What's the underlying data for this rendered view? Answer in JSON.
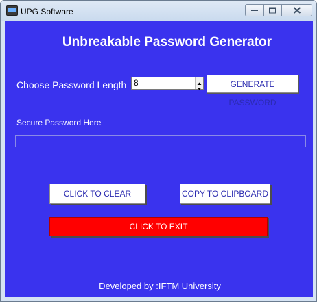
{
  "window": {
    "title": "UPG Software",
    "icon": "app-window-icon",
    "controls": {
      "minimize_icon": "minimize-icon",
      "maximize_icon": "maximize-icon",
      "close_icon": "close-icon"
    }
  },
  "main": {
    "heading": "Unbreakable Password Generator",
    "length_label": "Choose Password Length",
    "length_value": "8",
    "generate_button": "GENERATE PASSWORD",
    "password_label": "Secure Password Here",
    "password_value": "",
    "clear_button": "CLICK TO CLEAR",
    "copy_button": "COPY TO CLIPBOARD",
    "exit_button": "CLICK TO EXIT",
    "footer": "Developed by :IFTM University"
  },
  "colors": {
    "background": "#3a33ee",
    "button_text": "#2b2bb0",
    "exit_button": "#ff0000",
    "text": "#ffffff"
  }
}
